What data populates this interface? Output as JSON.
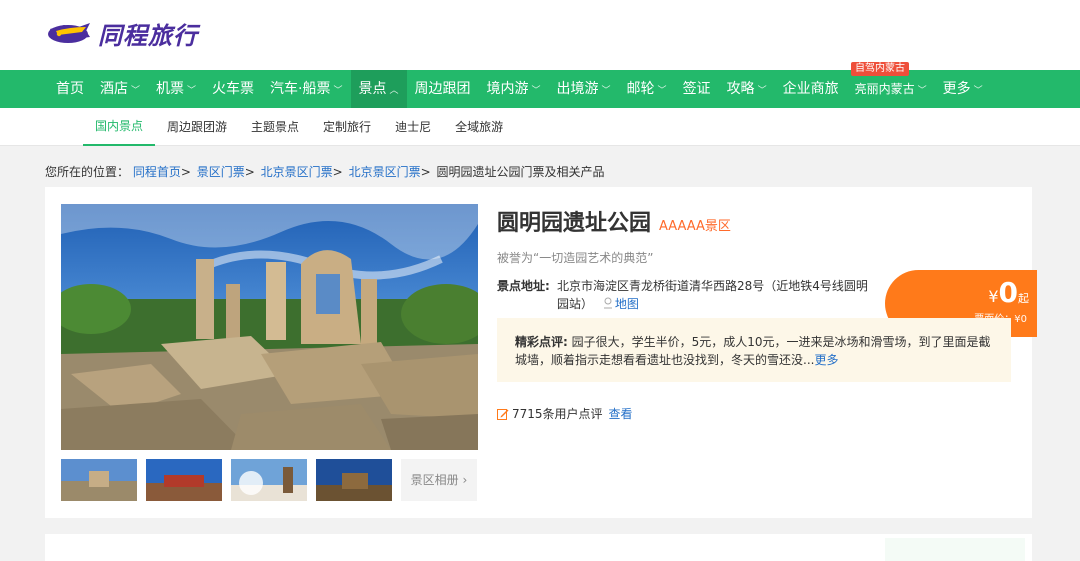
{
  "brand": {
    "name": "同程旅行"
  },
  "main_nav": {
    "items": [
      {
        "label": "首页",
        "caret": false
      },
      {
        "label": "酒店",
        "caret": true
      },
      {
        "label": "机票",
        "caret": true
      },
      {
        "label": "火车票",
        "caret": false
      },
      {
        "label": "汽车·船票",
        "caret": true
      },
      {
        "label": "景点",
        "caret": true,
        "active": true
      },
      {
        "label": "周边跟团",
        "caret": false
      },
      {
        "label": "境内游",
        "caret": true
      },
      {
        "label": "出境游",
        "caret": true
      },
      {
        "label": "邮轮",
        "caret": true
      },
      {
        "label": "签证",
        "caret": false
      },
      {
        "label": "攻略",
        "caret": true
      },
      {
        "label": "企业商旅",
        "caret": false
      },
      {
        "label": "亮丽内蒙古",
        "caret": true,
        "small": true
      },
      {
        "label": "更多",
        "caret": true
      }
    ],
    "promo_tag": "自驾内蒙古"
  },
  "sub_nav": {
    "items": [
      "国内景点",
      "周边跟团游",
      "主题景点",
      "定制旅行",
      "迪士尼",
      "全域旅游"
    ],
    "active_index": 0
  },
  "breadcrumb": {
    "prefix": "您所在的位置：",
    "links": [
      "同程首页",
      "景区门票",
      "北京景区门票",
      "北京景区门票"
    ],
    "current": "圆明园遗址公园门票及相关产品"
  },
  "attraction": {
    "name": "圆明园遗址公园",
    "level": "AAAAA景区",
    "slogan": "被誉为“一切造园艺术的典范”",
    "address_label": "景点地址:",
    "address": "北京市海淀区青龙桥街道清华西路28号（近地铁4号线圆明园站）",
    "map_link": "地图",
    "album_button": "景区相册",
    "review_label": "精彩点评:",
    "review_text": "园子很大，学生半价，5元，成人10元，一进来是冰场和滑雪场，到了里面是截城墙，顺着指示走想看看遗址也没找到，冬天的雪还没...",
    "review_more": "更多",
    "comment_count": "7715条用户点评",
    "comment_view": "查看"
  },
  "price": {
    "currency": "¥",
    "amount": "0",
    "suffix": "起",
    "original": "票面价：¥0"
  },
  "colors": {
    "nav_green": "#23b96b",
    "active_green": "#1e9e5b",
    "price_orange": "#ff7a1a",
    "link_blue": "#2570c8",
    "level_orange": "#ff6a2b"
  }
}
